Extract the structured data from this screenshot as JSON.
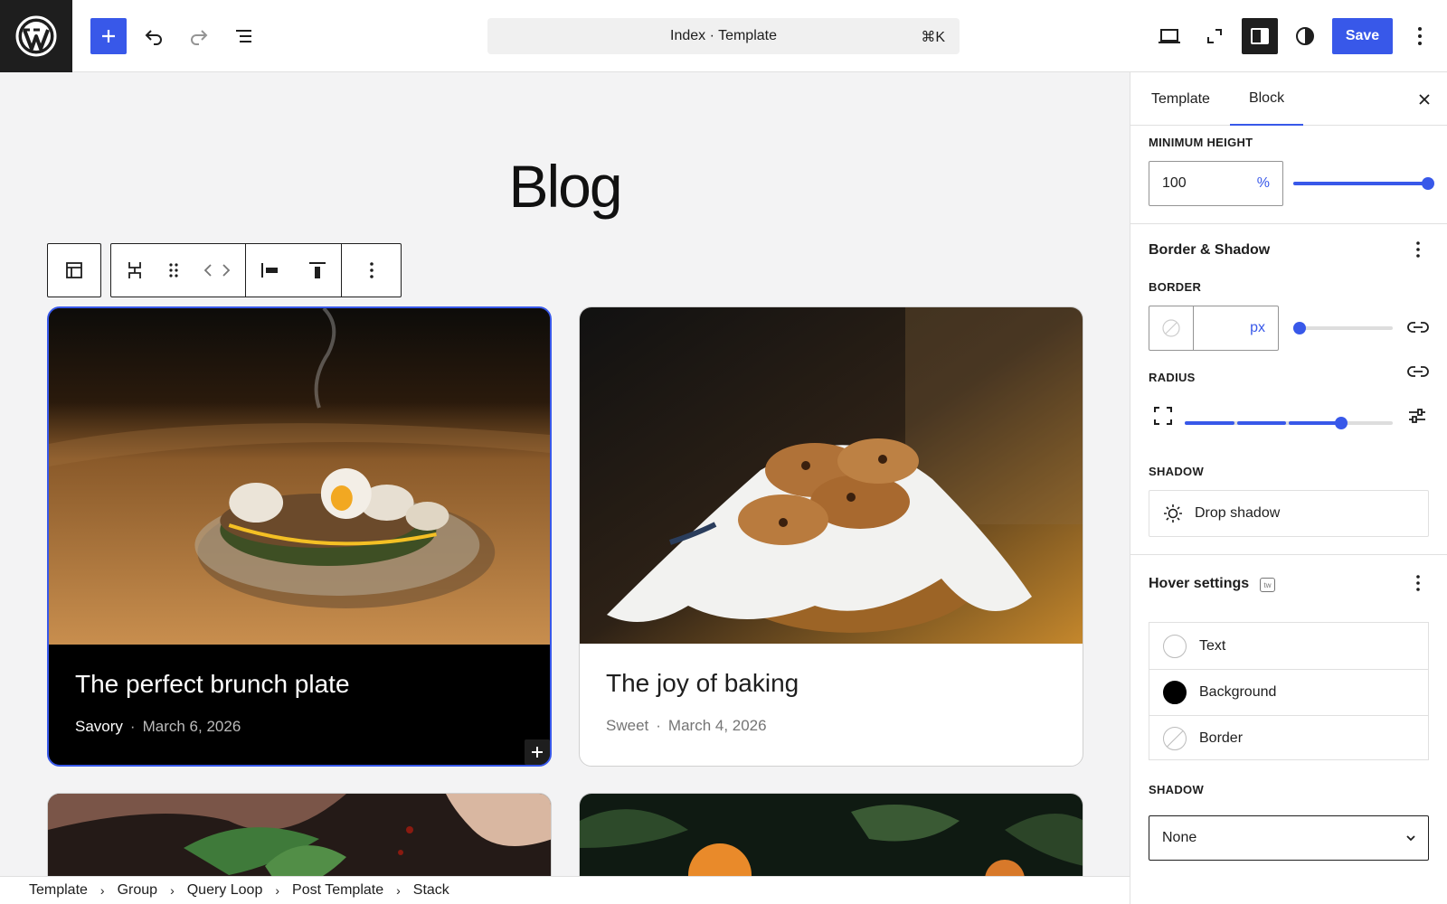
{
  "header": {
    "document_title": "Index · Template",
    "shortcut": "⌘K",
    "save_label": "Save"
  },
  "canvas": {
    "heading": "Blog",
    "posts": [
      {
        "title": "The perfect brunch plate",
        "category": "Savory",
        "separator": "·",
        "date": "March 6, 2026"
      },
      {
        "title": "The joy of baking",
        "category": "Sweet",
        "separator": "·",
        "date": "March 4, 2026"
      }
    ]
  },
  "breadcrumb": [
    "Template",
    "Group",
    "Query Loop",
    "Post Template",
    "Stack"
  ],
  "sidebar": {
    "tabs": [
      "Template",
      "Block"
    ],
    "active_tab": "Block",
    "min_height": {
      "label": "Minimum height",
      "value": "100",
      "unit": "%",
      "slider_fraction": 1.0
    },
    "border_shadow": {
      "title": "Border & Shadow",
      "border_label": "Border",
      "border_unit": "px",
      "border_slider_fraction": 0.0,
      "radius_label": "Radius",
      "radius_slider_fraction": 0.75,
      "shadow_label": "Shadow",
      "shadow_button": "Drop shadow"
    },
    "hover": {
      "title": "Hover settings",
      "badge": "tw",
      "items": [
        {
          "label": "Text",
          "swatch": "empty"
        },
        {
          "label": "Background",
          "swatch": "#000000"
        },
        {
          "label": "Border",
          "swatch": "none"
        }
      ],
      "shadow_label": "Shadow",
      "shadow_value": "None"
    }
  },
  "colors": {
    "accent": "#3858e9",
    "dark": "#1e1e1e"
  }
}
